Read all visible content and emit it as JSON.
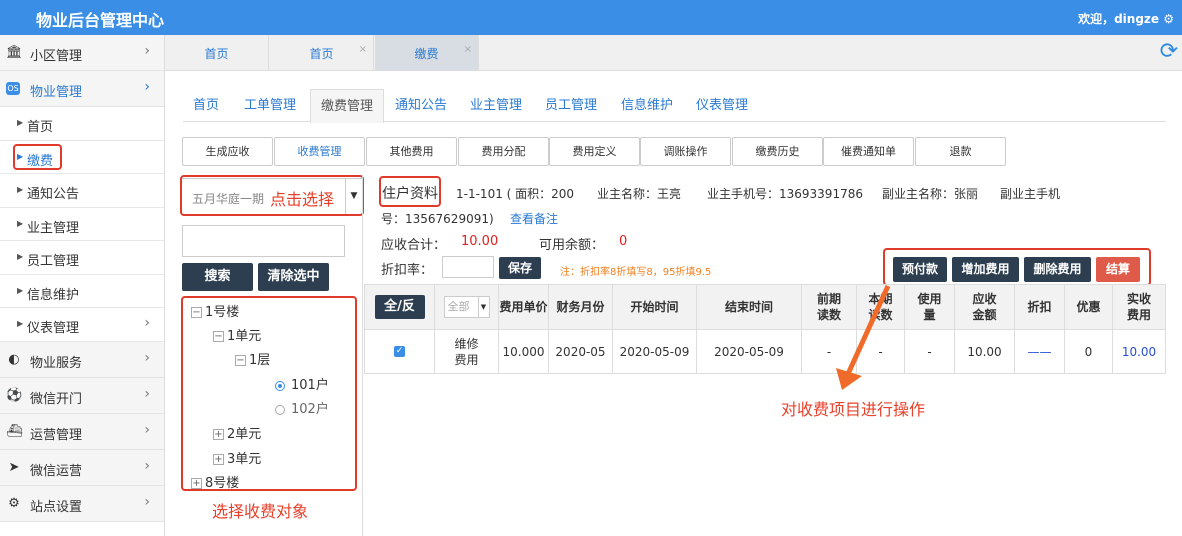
{
  "app": {
    "title": "物业后台管理中心",
    "welcome": "欢迎，dingze"
  },
  "sidebar": {
    "items": [
      {
        "label": "小区管理",
        "icon": "bank-icon"
      },
      {
        "label": "物业管理",
        "icon": "os-icon"
      },
      {
        "label": "物业服务",
        "icon": "toggle-icon"
      },
      {
        "label": "微信开门",
        "icon": "soccer-icon"
      },
      {
        "label": "运营管理",
        "icon": "ship-icon"
      },
      {
        "label": "微信运营",
        "icon": "send-icon"
      },
      {
        "label": "站点设置",
        "icon": "gears-icon"
      }
    ],
    "subitems": [
      "首页",
      "缴费",
      "通知公告",
      "业主管理",
      "员工管理",
      "信息维护",
      "仪表管理"
    ]
  },
  "page_tabs": [
    "首页",
    "首页",
    "缴费"
  ],
  "nav_tabs": [
    "首页",
    "工单管理",
    "缴费管理",
    "通知公告",
    "业主管理",
    "员工管理",
    "信息维护",
    "仪表管理"
  ],
  "sub_tabs": [
    "生成应收",
    "收费管理",
    "其他费用",
    "费用分配",
    "费用定义",
    "调账操作",
    "缴费历史",
    "催费通知单",
    "退款"
  ],
  "left": {
    "select_value": "五月华庭一期",
    "search_btn": "搜索",
    "clear_btn": "清除选中",
    "tree": {
      "b1": "1号楼",
      "u1": "1单元",
      "f1": "1层",
      "r101": "101户",
      "r102": "102户",
      "u2": "2单元",
      "u3": "3单元",
      "b8": "8号楼"
    }
  },
  "info": {
    "label": "住户资料",
    "room": "1-1-101 ( 面积：200",
    "owner": "业主名称：王亮",
    "owner_phone": "业主手机号：13693391786",
    "vice_owner": "副业主名称：张丽",
    "vice_phone_a": "副业主手机",
    "vice_phone_b": "号：13567629091)",
    "remark_link": "查看备注",
    "receivable_label": "应收合计：",
    "receivable_value": "10.00",
    "balance_label": "可用余额：",
    "balance_value": "0",
    "discount_label": "折扣率：",
    "save_btn": "保存",
    "note": "注：折扣率8折填写8，95折填9.5"
  },
  "actions": [
    "预付款",
    "增加费用",
    "删除费用",
    "结算"
  ],
  "table": {
    "all_btn": "全/反",
    "filter_placeholder": "全部",
    "headers": [
      "费用单价",
      "财务月份",
      "开始时间",
      "结束时间",
      "前期读数",
      "本期读数",
      "使用量",
      "应收金额",
      "折扣",
      "优惠",
      "实收费用"
    ],
    "row": {
      "name": "维修费用",
      "price": "10.000",
      "month": "2020-05",
      "start": "2020-05-09",
      "end": "2020-05-09",
      "prev": "-",
      "curr": "-",
      "usage": "-",
      "receivable": "10.00",
      "discount": "——",
      "coupon": "0",
      "actual": "10.00"
    }
  },
  "annotations": {
    "click_select": "点击选择",
    "select_target": "选择收费对象",
    "operate": "对收费项目进行操作"
  },
  "colors": {
    "topbar": "#3a8ee6",
    "annotation_red": "#e03a2a",
    "dark_btn": "#2c3e50"
  }
}
